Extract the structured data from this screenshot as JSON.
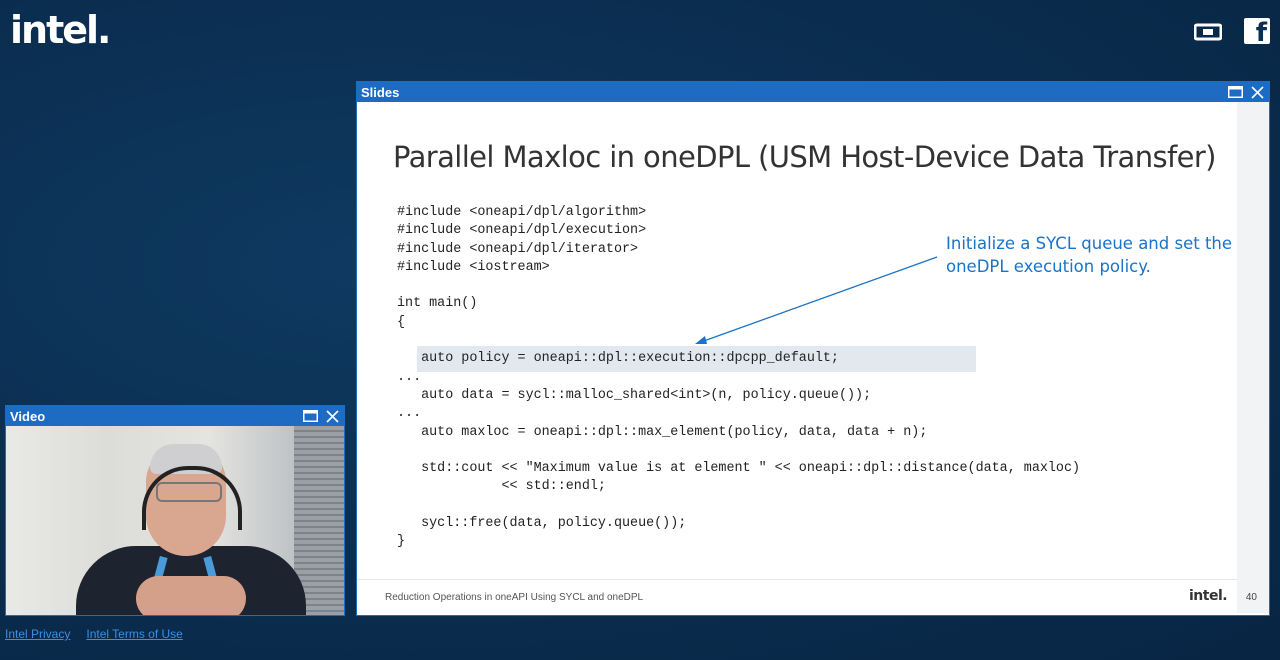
{
  "brand": {
    "logo_text": "intel."
  },
  "slides_window": {
    "title": "Slides",
    "slide": {
      "title": "Parallel Maxloc in oneDPL (USM Host-Device Data Transfer)",
      "code_lines": [
        "#include <oneapi/dpl/algorithm>",
        "#include <oneapi/dpl/execution>",
        "#include <oneapi/dpl/iterator>",
        "#include <iostream>",
        "",
        "int main()",
        "{",
        "",
        "   auto policy = oneapi::dpl::execution::dpcpp_default;",
        "...",
        "   auto data = sycl::malloc_shared<int>(n, policy.queue());",
        "...",
        "   auto maxloc = oneapi::dpl::max_element(policy, data, data + n);",
        "",
        "   std::cout << \"Maximum value is at element \" << oneapi::dpl::distance(data, maxloc)",
        "             << std::endl;",
        "",
        "   sycl::free(data, policy.queue());",
        "}"
      ],
      "annotation": "Initialize a SYCL queue and set the oneDPL execution policy.",
      "footer_text": "Reduction Operations in oneAPI Using SYCL and oneDPL",
      "footer_logo": "intel.",
      "page_number": "40"
    }
  },
  "video_window": {
    "title": "Video"
  },
  "links": {
    "privacy": "Intel Privacy",
    "terms": "Intel Terms of Use"
  },
  "colors": {
    "window_bar": "#1e6bc4",
    "annotation": "#1a73c8",
    "background": "#0b2f52"
  }
}
